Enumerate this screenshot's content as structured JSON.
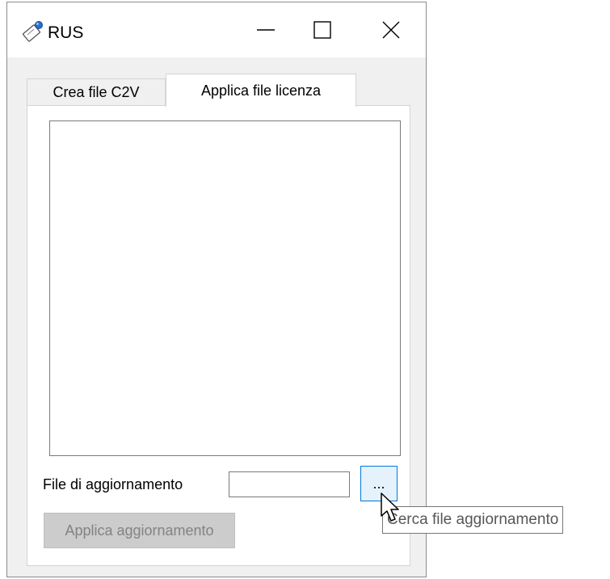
{
  "window": {
    "title": "RUS",
    "icon": "key-certificate-icon",
    "controls": {
      "minimize": "minimize-icon",
      "maximize": "maximize-icon",
      "close": "close-icon"
    }
  },
  "tabs": [
    {
      "label": "Crea file C2V",
      "active": false
    },
    {
      "label": "Applica file licenza",
      "active": true
    }
  ],
  "panel": {
    "log_text": "",
    "file_label": "File di aggiornamento",
    "file_value": "",
    "browse_label": "...",
    "apply_label": "Applica aggiornamento",
    "apply_enabled": false
  },
  "tooltip": {
    "text": "Cerca file aggiornamento"
  },
  "colors": {
    "accent": "#0078d7",
    "hover_fill": "#e5f1fb",
    "disabled_fill": "#cccccc",
    "disabled_text": "#838383"
  }
}
